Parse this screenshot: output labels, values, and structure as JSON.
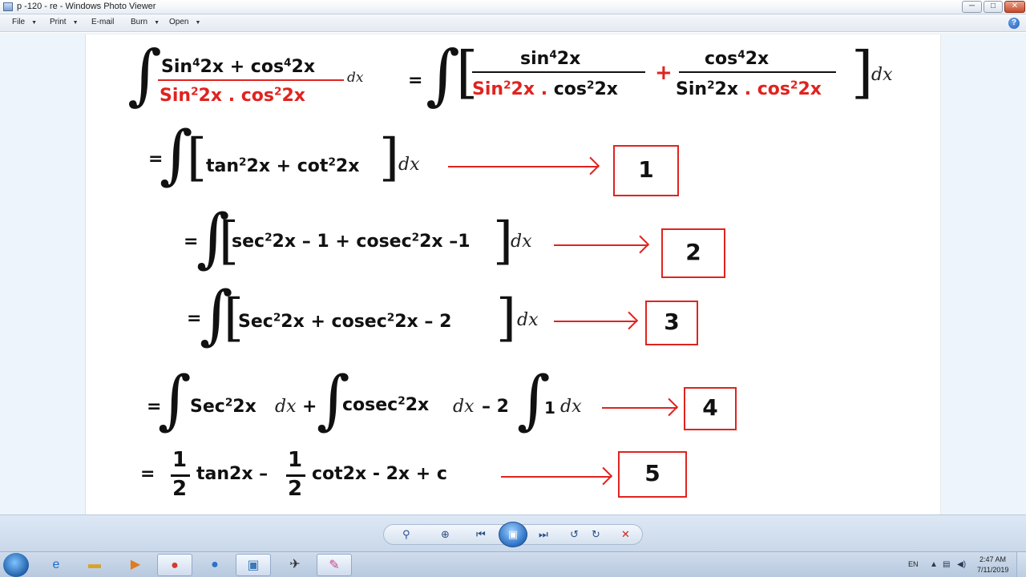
{
  "window": {
    "title": "p -120 - re - Windows Photo Viewer",
    "controls": {
      "minimize": "─",
      "maximize": "□",
      "close": "✕"
    }
  },
  "menu": {
    "file": "File",
    "print": "Print",
    "email": "E-mail",
    "burn": "Burn",
    "open": "Open",
    "help": "?"
  },
  "math": {
    "line0": {
      "num_a": "Sin",
      "num_a_exp": "4",
      "num_b": "2x + cos",
      "num_b_exp": "4",
      "num_c": "2x",
      "den_a": "Sin",
      "den_a_exp": "2",
      "den_b": "2x . cos",
      "den_b_exp": "2",
      "den_c": "2x",
      "dx": "dx",
      "eq": "=",
      "f1_num_a": "sin",
      "f1_num_exp": "4",
      "f1_num_b": "2x",
      "f1_den_a": "Sin",
      "f1_den_exp": "2",
      "f1_den_b": "2x .",
      "f1_den_c": "cos",
      "f1_den_exp2": "2",
      "f1_den_d": "2x",
      "plus": "+",
      "f2_num_a": "cos",
      "f2_num_exp": "4",
      "f2_num_b": "2x",
      "f2_den_a": "Sin",
      "f2_den_exp": "2",
      "f2_den_b": "2x",
      "f2_den_c": ". cos",
      "f2_den_exp2": "2",
      "f2_den_d": "2x",
      "dx2": "dx"
    },
    "line1": {
      "eq": "=",
      "a": "tan",
      "a_exp": "2",
      "b": "2x + cot",
      "b_exp": "2",
      "c": "2x",
      "dx": "dx",
      "step": "1"
    },
    "line2": {
      "eq": "=",
      "a": "sec",
      "a_exp": "2",
      "b": "2x – 1 + cosec",
      "b_exp": "2",
      "c": "2x –1",
      "dx": "dx",
      "step": "2"
    },
    "line3": {
      "eq": "=",
      "a": "Sec",
      "a_exp": "2",
      "b": "2x + cosec",
      "b_exp": "2",
      "c": "2x – 2",
      "dx": "dx",
      "step": "3"
    },
    "line4": {
      "eq": "=",
      "a": "Sec",
      "a_exp": "2",
      "b": "2x",
      "dx1": "dx",
      "plus": "+",
      "c": "cosec",
      "c_exp": "2",
      "d": "2x",
      "dx2": "dx",
      "minus2": "– 2",
      "one": "1",
      "dx3": "dx",
      "step": "4"
    },
    "line5": {
      "eq": "=",
      "n1": "1",
      "d1": "2",
      "t1": "tan2x –",
      "n2": "1",
      "d2": "2",
      "t2": "cot2x - 2x  + c",
      "step": "5"
    }
  },
  "colors": {
    "accent_red": "#e0231f"
  },
  "controls": {
    "zoom_icon": "⚲",
    "actual_size_icon": "⊕",
    "prev_icon": "⏮",
    "slideshow_icon": "▣",
    "next_icon": "⏭",
    "rotate_ccw_icon": "↺",
    "rotate_cw_icon": "↻",
    "delete_icon": "✕"
  },
  "taskbar": {
    "tray_lang": "EN",
    "time": "2:47 AM",
    "date": "7/11/2019"
  }
}
